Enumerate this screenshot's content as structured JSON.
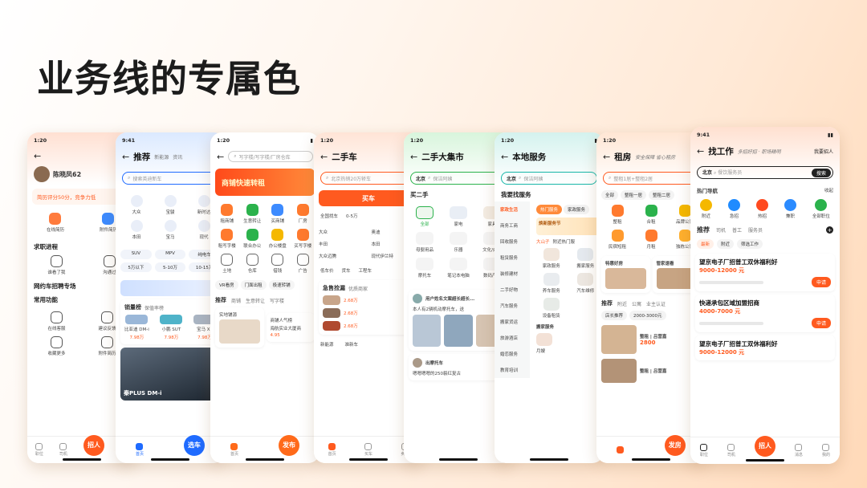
{
  "page": {
    "title": "业务线的专属色"
  },
  "colors": {
    "recruit": "#ff5a1f",
    "car": "#1f6bff",
    "house": "#ff6a1a",
    "usedcar": "#ff5a1f",
    "market": "#2bb24c",
    "local": "#18b6a8",
    "rent": "#ff5a1f",
    "job": "#ff5a1f"
  },
  "phones": [
    {
      "time": "1:20",
      "user": {
        "name": "陈晓凤62"
      },
      "resume_tip": "简历评分50分，竞争力低",
      "row_actions": [
        "在线简历",
        "附件简历"
      ],
      "sections": [
        "求职进程",
        "网约车招聘专场",
        "常用功能"
      ],
      "progress_items": [
        "谁看了我",
        "沟通过"
      ],
      "functions": [
        "在线客服",
        "建议反馈",
        "收藏更多",
        "附件简历"
      ],
      "tabs": [
        "职位",
        "司机",
        "招人",
        "消息",
        "我的"
      ],
      "fab": "招人"
    },
    {
      "time": "9:41",
      "tabs_top": [
        "推荐",
        "新能源",
        "资讯"
      ],
      "search_placeholder": "搜索英迪新车",
      "brands": [
        "大众",
        "宝骏",
        "新时达",
        "本田",
        "宝马",
        "现代"
      ],
      "filters": [
        "SUV",
        "MPV",
        "纯电车",
        "5万以下",
        "5-10万",
        "10-15万"
      ],
      "hot_title": "销量榜",
      "hot_sub": "保值率榜",
      "cars": [
        "比亚迪 DM-i",
        "小鹏 SUT",
        "宝马 X1"
      ],
      "car_prices": [
        "7.98万",
        "7.98万",
        "7.98万"
      ],
      "banner": "秦PLUS DM-i",
      "tabs": [
        "首页",
        "选车"
      ],
      "fab": "选车"
    },
    {
      "time": "1:20",
      "search_placeholder": "写字楼/写字楼/厂房仓库",
      "banner": "商铺快速转租",
      "grid": [
        "租商铺",
        "生意转让",
        "买商铺",
        "厂房",
        "租写字楼",
        "联合办公",
        "办公楼盘",
        "买写字楼",
        "土地",
        "仓库",
        "借钱",
        "广告"
      ],
      "vr": [
        "VR看房",
        "门面出租",
        "极速转铺"
      ],
      "tabs_row": [
        "推荐",
        "商铺",
        "生意转让",
        "写字楼"
      ],
      "listings": [
        "实地铺源",
        "商铺人气榜"
      ],
      "item_title": "海航实业大厦商",
      "item_price": "4.95",
      "tabs": [
        "首页",
        "发布"
      ],
      "fab": "发布"
    },
    {
      "time": "1:20",
      "title": "二手车",
      "search_placeholder": "北京热销20万轿车",
      "buy_btn": "买车",
      "price_ranges": [
        "全国找车",
        "0-5万"
      ],
      "brands": [
        "大众",
        "奥迪",
        "丰田",
        "本田",
        "大众迈腾",
        "现代伊兰特"
      ],
      "row": [
        "低车价",
        "货车",
        "工程车"
      ],
      "deals_title": "急售捡漏",
      "deals_sub": "优质商家",
      "prices": [
        "2.68万",
        "2.68万",
        "2.68万"
      ],
      "new_energy": [
        "新能源",
        "准新车"
      ],
      "tabs": [
        "首页",
        "买车",
        "卖车"
      ]
    },
    {
      "time": "1:20",
      "title": "二手大集市",
      "city": "北京",
      "search_placeholder": "保洁阿姨",
      "sub_header": "买二手",
      "cats": [
        "全部",
        "家电",
        "家具",
        "母婴用品",
        "乐器",
        "文化/办公",
        "摩托车",
        "笔记本电脑",
        "数码产品"
      ],
      "post_user": "用户姓名文案超长超长...",
      "post_text": "本人有2辆机动摩托车，送",
      "post_user2": "出摩托车",
      "post_text2": "嗯嗯嗯嗯的250裂红复古"
    },
    {
      "time": "1:20",
      "title": "本地服务",
      "city": "北京",
      "search_placeholder": "保洁阿姨",
      "find_service": "我要找服务",
      "left_nav": [
        "家政生活",
        "商务工商",
        "回收服务",
        "租赁服务",
        "装修建材",
        "二手好物",
        "汽车服务",
        "搬家货运",
        "旅游酒店",
        "婚恋服务",
        "教育培训"
      ],
      "service_tags": [
        "热门服务",
        "家政服务"
      ],
      "banner": "焕新服务节",
      "tags2": [
        "大山子",
        "附近热门服"
      ],
      "services": [
        "家政服务",
        "搬家服务",
        "养车服务",
        "汽车维修",
        "设备租赁"
      ],
      "move_title": "搬家服务",
      "move_tag": "月嫂"
    },
    {
      "time": "1:20",
      "title": "租房",
      "title_sub": "安全保障 省心租房",
      "search_placeholder": "整租1居+整租2居",
      "chips": [
        "全部",
        "整租一居",
        "整租二居"
      ],
      "grid": [
        "整租",
        "合租",
        "品牌公寓",
        "民宿短租",
        "月租",
        "独栋公寓"
      ],
      "promos": [
        "特惠好房",
        "管家速看"
      ],
      "tabs_row": [
        "推荐",
        "附近",
        "公寓",
        "业主认证"
      ],
      "filters": [
        "店长推荐",
        "2000-3000元"
      ],
      "listing1_title": "整租 | 吕营嘉",
      "listing1_price": "2800",
      "listing2_title": "整租 | 吕营嘉",
      "fab": "发房"
    },
    {
      "time": "9:41",
      "title": "找工作",
      "title_sub": "多招好招 · 职场精明",
      "recruit_link": "我要招人",
      "city": "北京",
      "search_placeholder": "餐饮服务员",
      "search_btn": "搜索",
      "hot_nav": "热门导航",
      "collapse": "收起",
      "nav": [
        "附近",
        "急招",
        "热招",
        "兼职",
        "全部职位"
      ],
      "tabs_row": [
        "推荐",
        "司机",
        "普工",
        "服务员"
      ],
      "sub_filters": [
        "最新",
        "附近",
        "筛选工作"
      ],
      "jobs": [
        {
          "title": "望京电子厂招普工双休福利好",
          "salary": "9000-12000 元",
          "apply": "申请"
        },
        {
          "title": "快递承包区域加盟招商",
          "salary": "4000-7000 元",
          "apply": "申请"
        },
        {
          "title": "望京电子厂招普工双休福利好",
          "salary": "9000-12000 元",
          "apply": "申请"
        }
      ],
      "tabs": [
        "职位",
        "司机",
        "招人",
        "消息",
        "我的"
      ],
      "fab": "招人"
    }
  ]
}
